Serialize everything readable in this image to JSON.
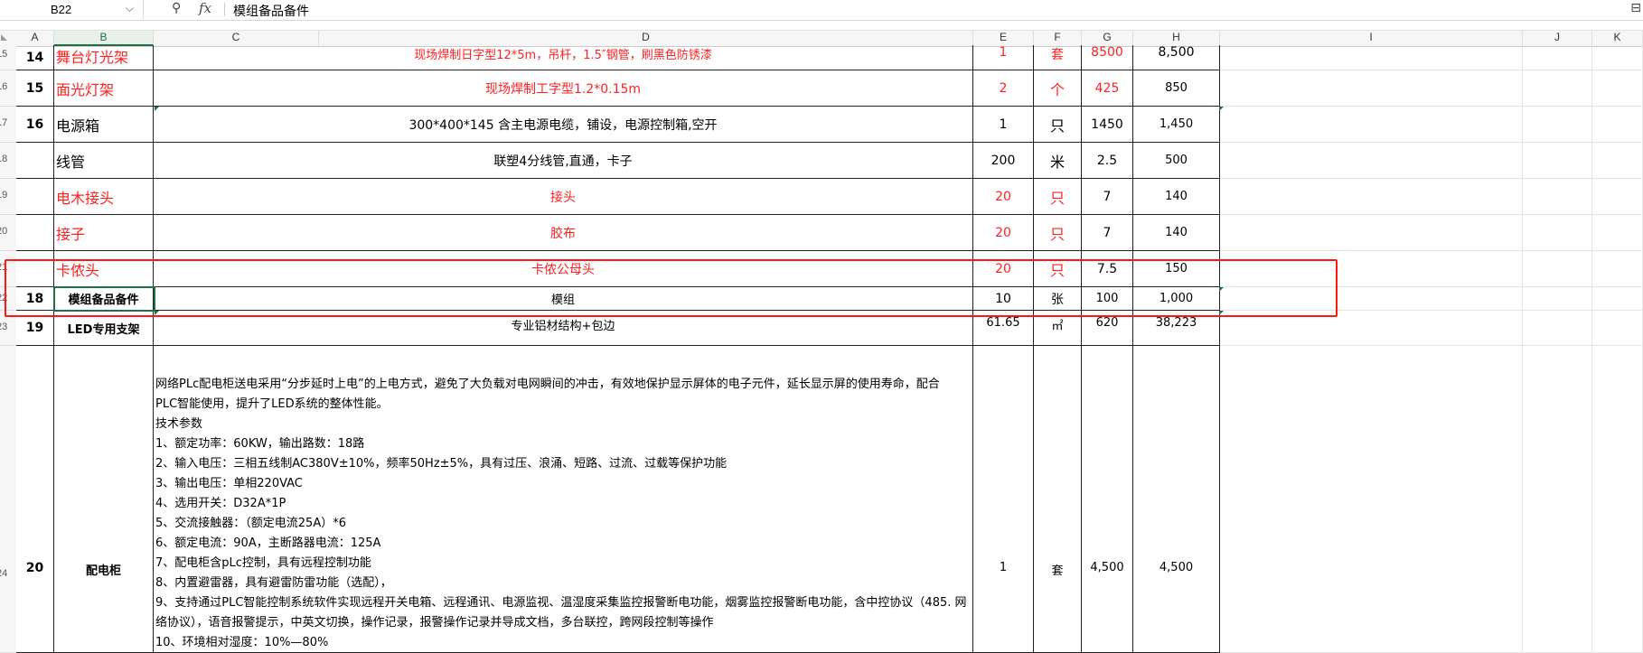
{
  "formula_bar": {
    "name_box": "B22",
    "content": "模组备品备件",
    "zoom_icon": "magnifier-icon",
    "fx_label": "fx"
  },
  "columns": [
    "A",
    "B",
    "C",
    "D",
    "E",
    "F",
    "G",
    "H",
    "I",
    "J",
    "K"
  ],
  "row_headers": [
    "15",
    "16",
    "17",
    "18",
    "19",
    "20",
    "21",
    "22",
    "23",
    "24"
  ],
  "rows": [
    {
      "no": "14",
      "name": "舞台灯光架",
      "spec": "现场焊制日字型12*5m，吊杆，1.5″钢管，刷黑色防锈漆",
      "qty": "1",
      "unit": "套",
      "price": "8500",
      "total": "8,500",
      "color": "#ff1f1f"
    },
    {
      "no": "15",
      "name": "面光灯架",
      "spec": "现场焊制工字型1.2*0.15m",
      "qty": "2",
      "unit": "个",
      "price": "425",
      "total": "850",
      "color": "#ff1f1f"
    },
    {
      "no": "16",
      "name": "电源箱",
      "spec": "300*400*145 含主电源电缆，铺设，电源控制箱,空开",
      "qty": "1",
      "unit": "只",
      "price": "1450",
      "total": "1,450",
      "color": "#000000"
    },
    {
      "no": "",
      "name": "线管",
      "spec": "联塑4分线管,直通，卡子",
      "qty": "200",
      "unit": "米",
      "price": "2.5",
      "total": "500",
      "color": "#000000"
    },
    {
      "no": "",
      "name": "电木接头",
      "spec": "接头",
      "qty": "20",
      "unit": "只",
      "price": "7",
      "total": "140",
      "color": "#ff1f1f"
    },
    {
      "no": "",
      "name": "接子",
      "spec": "胶布",
      "qty": "20",
      "unit": "只",
      "price": "7",
      "total": "140",
      "color": "#ff1f1f"
    },
    {
      "no": "",
      "name": "卡侬头",
      "spec": "卡侬公母头",
      "qty": "20",
      "unit": "只",
      "price": "7.5",
      "total": "150",
      "color": "#ff1f1f"
    },
    {
      "no": "18",
      "name": "模组备品备件",
      "spec": "模组",
      "qty": "10",
      "unit": "张",
      "price": "100",
      "total": "1,000",
      "color": "#000000"
    },
    {
      "no": "19",
      "name": "LED专用支架",
      "spec": "专业铝材结构+包边",
      "qty": "61.65",
      "unit": "㎡",
      "price": "620",
      "total": "38,223",
      "color": "#000000"
    },
    {
      "no": "20",
      "name": "配电柜",
      "spec": "",
      "qty": "1",
      "unit": "套",
      "price": "4,500",
      "total": "4,500",
      "color": "#000000"
    }
  ],
  "cabinet_description": [
    "网络PLc配电柜送电采用“分步延时上电”的上电方式，避免了大负载对电网瞬间的冲击，有效地保护显示屏体的电子元件，延长显示屏的使用寿命，配合",
    "PLC智能使用，提升了LED系统的整体性能。",
    "技术参数",
    "1、额定功率：60KW，输出路数：18路",
    "2、输入电压：三相五线制AC380V±10%，频率50Hz±5%，具有过压、浪涌、短路、过流、过载等保护功能",
    "3、输出电压：单相220VAC",
    "4、选用开关：D32A*1P",
    "5、交流接触器：（额定电流25A）*6",
    "6、额定电流：90A，主断路器电流：125A",
    "7、配电柜含pLc控制，具有远程控制功能",
    "8、内置避雷器，具有避雷防雷功能（选配），",
    "9、支持通过PLC智能控制系统软件实现远程开关电箱、远程通讯、电源监视、温湿度采集监控报警断电功能，烟雾监控报警断电功能，含中控协议（485. 网",
    "络协议），语音报警提示，中英文切换，操作记录，报警操作记录并导成文档，多台联控，跨网段控制等操作",
    "10、环境相对湿度：10%—80%"
  ],
  "colors": {
    "red_text": "#ff1f1f",
    "selection": "#1e7145",
    "highlight_box": "#ff1616"
  }
}
